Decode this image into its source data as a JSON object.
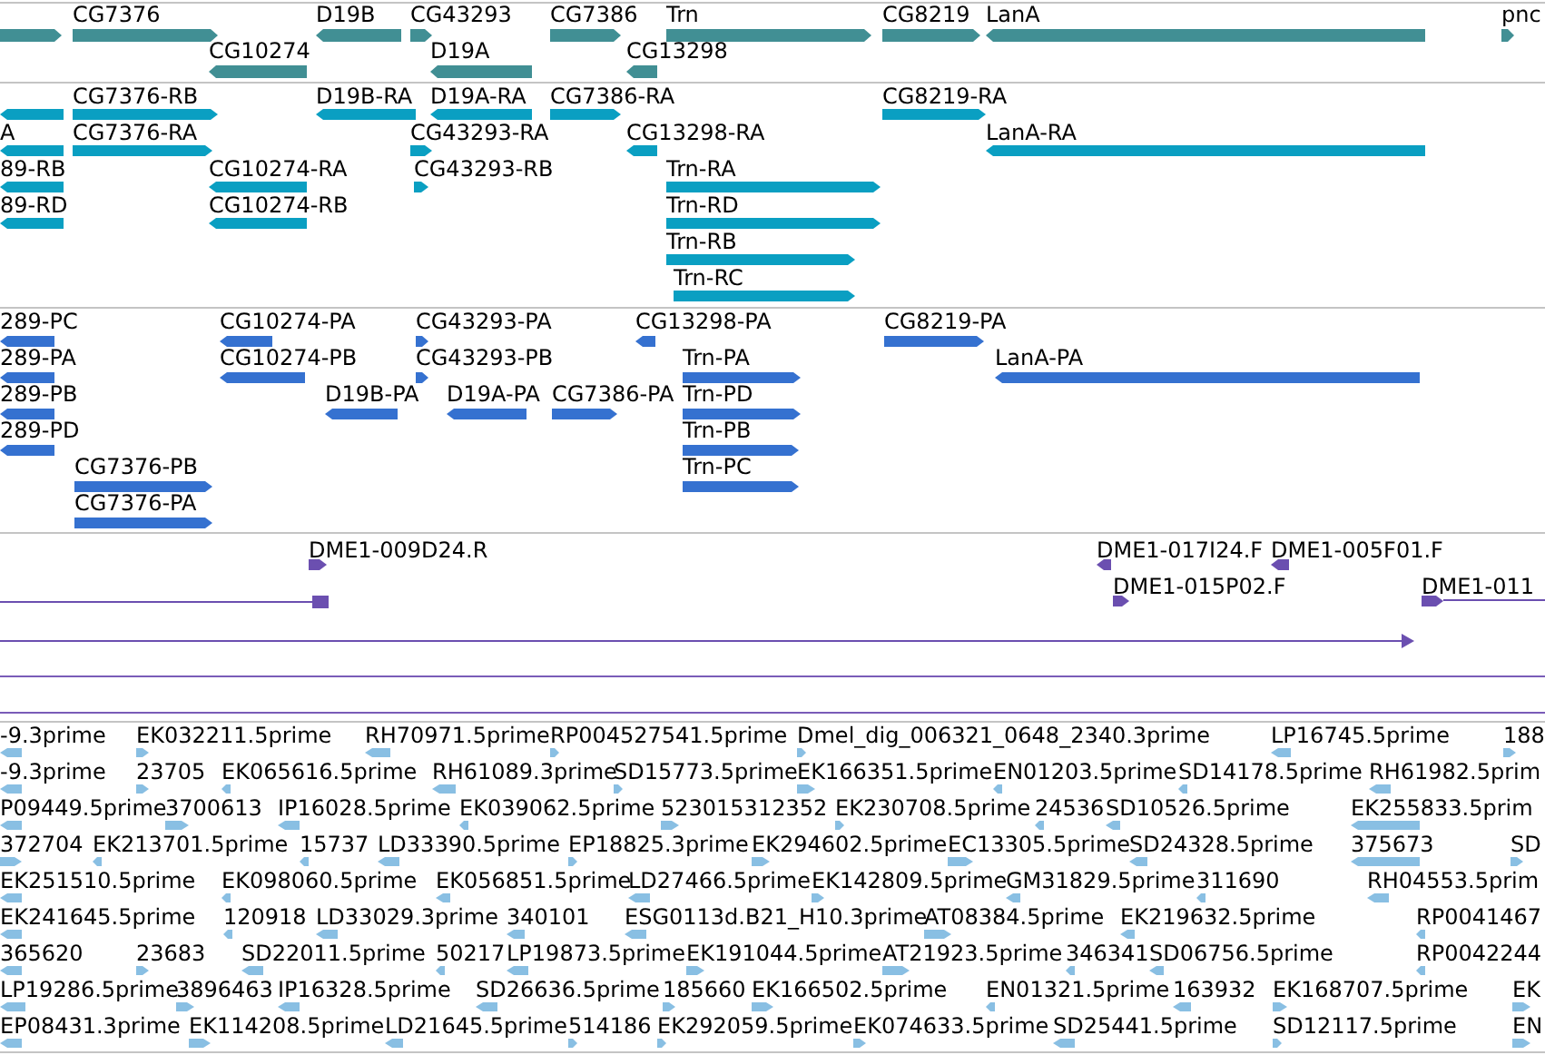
{
  "tracks": [
    {
      "kind": "gene",
      "features": [
        {
          "reverse": false
        },
        {
          "label": "CG7376",
          "reverse": false
        },
        {
          "label": "D19B",
          "reverse": true
        },
        {
          "label": "CG43293",
          "reverse": false
        },
        {
          "label": "CG7386",
          "reverse": false
        },
        {
          "label": "Trn",
          "reverse": false
        },
        {
          "label": "CG8219",
          "reverse": false
        },
        {
          "label": "LanA",
          "reverse": true
        },
        {
          "label": "pnc",
          "reverse": false
        },
        {
          "label": "CG10274",
          "reverse": true
        },
        {
          "label": "D19A",
          "reverse": true
        },
        {
          "label": "CG13298",
          "reverse": true
        }
      ]
    },
    {
      "kind": "transcript",
      "features": [
        {
          "reverse": true
        },
        {
          "label": "A",
          "reverse": true
        },
        {
          "label": "89-RB",
          "reverse": true
        },
        {
          "label": "89-RD",
          "reverse": true
        },
        {
          "label": "CG7376-RB",
          "reverse": false
        },
        {
          "label": "CG7376-RA",
          "reverse": false
        },
        {
          "label": "D19B-RA",
          "reverse": true
        },
        {
          "label": "D19A-RA",
          "reverse": true
        },
        {
          "label": "CG7386-RA",
          "reverse": false
        },
        {
          "label": "CG43293-RA",
          "reverse": false
        },
        {
          "label": "CG43293-RB",
          "reverse": false
        },
        {
          "label": "CG13298-RA",
          "reverse": true
        },
        {
          "label": "CG10274-RA",
          "reverse": true
        },
        {
          "label": "CG10274-RB",
          "reverse": true
        },
        {
          "label": "Trn-RA",
          "reverse": false
        },
        {
          "label": "Trn-RD",
          "reverse": false
        },
        {
          "label": "Trn-RB",
          "reverse": false
        },
        {
          "label": "Trn-RC",
          "reverse": false
        },
        {
          "label": "CG8219-RA",
          "reverse": false
        },
        {
          "label": "LanA-RA",
          "reverse": true
        }
      ]
    },
    {
      "kind": "protein",
      "features": [
        {
          "label": "289-PC",
          "reverse": true
        },
        {
          "label": "289-PA",
          "reverse": true
        },
        {
          "label": "289-PB",
          "reverse": true
        },
        {
          "label": "289-PD",
          "reverse": true
        },
        {
          "label": "CG10274-PA",
          "reverse": true
        },
        {
          "label": "CG10274-PB",
          "reverse": true
        },
        {
          "label": "CG43293-PA",
          "reverse": false
        },
        {
          "label": "CG43293-PB",
          "reverse": false
        },
        {
          "label": "CG13298-PA",
          "reverse": true
        },
        {
          "label": "D19B-PA",
          "reverse": true
        },
        {
          "label": "D19A-PA",
          "reverse": true
        },
        {
          "label": "CG7386-PA",
          "reverse": false
        },
        {
          "label": "Trn-PA",
          "reverse": false
        },
        {
          "label": "Trn-PD",
          "reverse": false
        },
        {
          "label": "Trn-PB",
          "reverse": false
        },
        {
          "label": "Trn-PC",
          "reverse": false
        },
        {
          "label": "CG7376-PB",
          "reverse": false
        },
        {
          "label": "CG7376-PA",
          "reverse": false
        },
        {
          "label": "CG8219-PA",
          "reverse": false
        },
        {
          "label": "LanA-PA",
          "reverse": true
        }
      ]
    },
    {
      "kind": "clone",
      "features": [
        {
          "label": "DME1-009D24.R",
          "reverse": false
        },
        {
          "label": "DME1-017I24.F",
          "reverse": true
        },
        {
          "label": "DME1-005F01.F",
          "reverse": true
        },
        {
          "label": "DME1-015P02.F",
          "reverse": false
        },
        {
          "label": "DME1-011",
          "reverse": false
        }
      ]
    },
    {
      "kind": "est",
      "rows": [
        {
          "features": [
            {
              "label": "-9.3prime",
              "reverse": true
            },
            {
              "label": "EK032211.5prime",
              "reverse": false
            },
            {
              "label": "RH70971.5prime",
              "reverse": true
            },
            {
              "label": "RP004527541.5prime",
              "reverse": false
            },
            {
              "label": "Dmel_dig_006321_0648_2340.3prime",
              "reverse": false
            },
            {
              "label": "LP16745.5prime",
              "reverse": true
            },
            {
              "label": "188",
              "reverse": false
            }
          ]
        },
        {
          "features": [
            {
              "label": "-9.3prime",
              "reverse": true
            },
            {
              "label": "23705",
              "reverse": false
            },
            {
              "label": "EK065616.5prime",
              "reverse": true
            },
            {
              "label": "RH61089.3prime",
              "reverse": true
            },
            {
              "label": "SD15773.5prime",
              "reverse": false
            },
            {
              "label": "EK166351.5prime",
              "reverse": false
            },
            {
              "label": "EN01203.5prime",
              "reverse": true
            },
            {
              "label": "SD14178.5prime",
              "reverse": true
            },
            {
              "label": "RH61982.5prim",
              "reverse": true
            }
          ]
        },
        {
          "features": [
            {
              "label": "P09449.5prime",
              "reverse": true
            },
            {
              "label": "3700613",
              "reverse": false
            },
            {
              "label": "IP16028.5prime",
              "reverse": true
            },
            {
              "label": "EK039062.5prime",
              "reverse": true
            },
            {
              "label": "523015312352",
              "reverse": false
            },
            {
              "label": "EK230708.5prime",
              "reverse": false
            },
            {
              "label": "24536",
              "reverse": true
            },
            {
              "label": "SD10526.5prime",
              "reverse": true
            },
            {
              "label": "EK255833.5prim",
              "reverse": true
            }
          ]
        },
        {
          "features": [
            {
              "label": "372704",
              "reverse": false
            },
            {
              "label": "EK213701.5prime",
              "reverse": true
            },
            {
              "label": "15737",
              "reverse": true
            },
            {
              "label": "LD33390.5prime",
              "reverse": true
            },
            {
              "label": "EP18825.3prime",
              "reverse": false
            },
            {
              "label": "EK294602.5prime",
              "reverse": false
            },
            {
              "label": "EC13305.5prime",
              "reverse": false
            },
            {
              "label": "SD24328.5prime",
              "reverse": true
            },
            {
              "label": "375673",
              "reverse": true
            },
            {
              "label": "SD",
              "reverse": false
            }
          ]
        },
        {
          "features": [
            {
              "label": "EK251510.5prime",
              "reverse": true
            },
            {
              "label": "EK098060.5prime",
              "reverse": true
            },
            {
              "label": "EK056851.5prime",
              "reverse": true
            },
            {
              "label": "LD27466.5prime",
              "reverse": true
            },
            {
              "label": "EK142809.5prime",
              "reverse": false
            },
            {
              "label": "GM31829.5prime",
              "reverse": true
            },
            {
              "label": "311690",
              "reverse": true
            },
            {
              "label": "RH04553.5prim",
              "reverse": true
            }
          ]
        },
        {
          "features": [
            {
              "label": "EK241645.5prime",
              "reverse": true
            },
            {
              "label": "120918",
              "reverse": true
            },
            {
              "label": "LD33029.3prime",
              "reverse": true
            },
            {
              "label": "340101",
              "reverse": true
            },
            {
              "label": "ESG0113d.B21_H10.3prime",
              "reverse": true
            },
            {
              "label": "AT08384.5prime",
              "reverse": false
            },
            {
              "label": "EK219632.5prime",
              "reverse": true
            },
            {
              "label": "RP0041467",
              "reverse": true
            }
          ]
        },
        {
          "features": [
            {
              "label": "365620",
              "reverse": true
            },
            {
              "label": "23683",
              "reverse": false
            },
            {
              "label": "SD22011.5prime",
              "reverse": true
            },
            {
              "label": "50217",
              "reverse": true
            },
            {
              "label": "LP19873.5prime",
              "reverse": true
            },
            {
              "label": "EK191044.5prime",
              "reverse": false
            },
            {
              "label": "AT21923.5prime",
              "reverse": false
            },
            {
              "label": "346341",
              "reverse": true
            },
            {
              "label": "SD06756.5prime",
              "reverse": true
            },
            {
              "label": "RP0042244",
              "reverse": true
            }
          ]
        },
        {
          "features": [
            {
              "label": "LP19286.5prime",
              "reverse": true
            },
            {
              "label": "3896463",
              "reverse": false
            },
            {
              "label": "IP16328.5prime",
              "reverse": true
            },
            {
              "label": "SD26636.5prime",
              "reverse": true
            },
            {
              "label": "185660",
              "reverse": false
            },
            {
              "label": "EK166502.5prime",
              "reverse": false
            },
            {
              "label": "EN01321.5prime",
              "reverse": true
            },
            {
              "label": "163932",
              "reverse": true
            },
            {
              "label": "EK168707.5prime",
              "reverse": false
            },
            {
              "label": "EK",
              "reverse": false
            }
          ]
        },
        {
          "features": [
            {
              "label": "EP08431.3prime",
              "reverse": true
            },
            {
              "label": "EK114208.5prime",
              "reverse": false
            },
            {
              "label": "LD21645.5prime",
              "reverse": true
            },
            {
              "label": "514186",
              "reverse": false
            },
            {
              "label": "EK292059.5prime",
              "reverse": false
            },
            {
              "label": "EK074633.5prime",
              "reverse": false
            },
            {
              "label": "SD25441.5prime",
              "reverse": true
            },
            {
              "label": "SD12117.5prime",
              "reverse": false
            },
            {
              "label": "EN",
              "reverse": false
            }
          ]
        }
      ]
    }
  ]
}
